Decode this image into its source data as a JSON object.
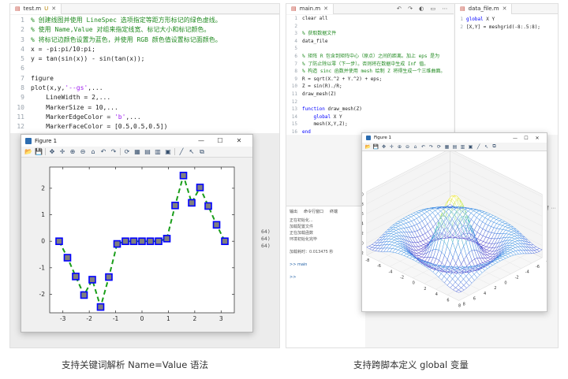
{
  "left_editor": {
    "tab_name": "test.m",
    "tab_marker": "U",
    "lines": [
      {
        "n": "1",
        "tokens": [
          {
            "t": "% 创建线图并使用 LineSpec 选项指定等距方形标记的绿色虚线。",
            "c": "c-cm"
          }
        ]
      },
      {
        "n": "2",
        "tokens": [
          {
            "t": "% 使用 Name,Value 对组来指定线宽、标记大小和标记颜色。",
            "c": "c-cm"
          }
        ]
      },
      {
        "n": "3",
        "tokens": [
          {
            "t": "% 将标记边颜色设置为蓝色，并使用 RGB 颜色值设置标记面颜色。",
            "c": "c-cm"
          }
        ]
      },
      {
        "n": "4",
        "tokens": [
          {
            "t": "x = -pi:pi/10:pi;",
            "c": "c-tx"
          }
        ]
      },
      {
        "n": "5",
        "tokens": [
          {
            "t": "y = tan(sin(x)) - sin(tan(x));",
            "c": "c-tx"
          }
        ]
      },
      {
        "n": "6",
        "tokens": [
          {
            "t": "",
            "c": "c-tx"
          }
        ]
      },
      {
        "n": "7",
        "tokens": [
          {
            "t": "figure",
            "c": "c-tx"
          }
        ]
      },
      {
        "n": "8",
        "tokens": [
          {
            "t": "plot(x,y,",
            "c": "c-tx"
          },
          {
            "t": "'--gs'",
            "c": "c-str"
          },
          {
            "t": ",...",
            "c": "c-tx"
          }
        ]
      },
      {
        "n": "9",
        "tokens": [
          {
            "t": "    LineWidth = 2,...",
            "c": "c-tx"
          }
        ]
      },
      {
        "n": "10",
        "tokens": [
          {
            "t": "    MarkerSize = 10,...",
            "c": "c-tx"
          }
        ]
      },
      {
        "n": "11",
        "tokens": [
          {
            "t": "    MarkerEdgeColor = ",
            "c": "c-tx"
          },
          {
            "t": "'b'",
            "c": "c-str"
          },
          {
            "t": ",...",
            "c": "c-tx"
          }
        ]
      },
      {
        "n": "12",
        "tokens": [
          {
            "t": "    MarkerFaceColor = [0.5,0.5,0.5])",
            "c": "c-tx"
          }
        ]
      }
    ],
    "ghost_text": [
      "64)",
      "64)",
      "64)"
    ]
  },
  "figure1": {
    "title": "Figure 1",
    "controls": [
      "—",
      "☐",
      "✕"
    ],
    "toolbar_icons": [
      "open-icon",
      "save-icon",
      "pan-icon",
      "datatip-icon",
      "zoom-in-icon",
      "zoom-out-icon",
      "home-icon",
      "undo-icon",
      "redo-icon",
      "rotate-icon",
      "grid-icon",
      "legend-icon",
      "colorbar-icon",
      "box-icon",
      "line-icon",
      "pointer-icon",
      "dock-icon"
    ]
  },
  "chart_data": {
    "type": "line",
    "line_style": "--",
    "line_color": "#1a9e1a",
    "marker": "square",
    "marker_face": "#7f7f7f",
    "marker_edge": "#0000ff",
    "x": [
      -3.1416,
      -2.8274,
      -2.5133,
      -2.1991,
      -1.885,
      -1.5708,
      -1.2566,
      -0.9425,
      -0.6283,
      -0.3142,
      0,
      0.3142,
      0.6283,
      0.9425,
      1.2566,
      1.5708,
      1.885,
      2.1991,
      2.5133,
      2.8274,
      3.1416
    ],
    "y": [
      0,
      -0.62,
      -1.33,
      -2.03,
      -1.45,
      -2.48,
      -1.35,
      -0.1,
      0,
      0,
      0,
      0,
      0,
      0.1,
      1.35,
      2.48,
      1.45,
      2.03,
      1.33,
      0.62,
      0
    ],
    "xticks": [
      "-3",
      "-2",
      "-1",
      "0",
      "1",
      "2",
      "3"
    ],
    "xtick_vals": [
      -3,
      -2,
      -1,
      0,
      1,
      2,
      3
    ],
    "yticks": [
      "-2",
      "-1",
      "0",
      "1",
      "2"
    ],
    "ytick_vals": [
      -2,
      -1,
      0,
      1,
      2
    ],
    "xlim": [
      -3.5,
      3.5
    ],
    "ylim": [
      -2.7,
      2.8
    ],
    "grid": false
  },
  "right_editor": {
    "tab_name": "main.m",
    "side_tab_name": "data_file.m",
    "lines": [
      {
        "n": "1",
        "tokens": [
          {
            "t": "clear all",
            "c": "c-tx"
          }
        ]
      },
      {
        "n": "2",
        "tokens": [
          {
            "t": "",
            "c": "c-tx"
          }
        ]
      },
      {
        "n": "3",
        "tokens": [
          {
            "t": "% 获取数据文件",
            "c": "c-cm"
          }
        ]
      },
      {
        "n": "4",
        "tokens": [
          {
            "t": "data_file",
            "c": "c-tx"
          }
        ]
      },
      {
        "n": "5",
        "tokens": [
          {
            "t": "",
            "c": "c-tx"
          }
        ]
      },
      {
        "n": "6",
        "tokens": [
          {
            "t": "% 矩阵 R 包含到矩阵中心（原点）之间的距离。加上 eps 是为",
            "c": "c-cm"
          }
        ]
      },
      {
        "n": "7",
        "tokens": [
          {
            "t": "% 了防止除以零（下一步）。否则将在数据中生成 Inf 值。",
            "c": "c-cm"
          }
        ]
      },
      {
        "n": "8",
        "tokens": [
          {
            "t": "% 构造 sinc 函数并使用 mesh 绘制 Z 将得生成一个三维曲面。",
            "c": "c-cm"
          }
        ]
      },
      {
        "n": "9",
        "tokens": [
          {
            "t": "R = sqrt(X.^2 + Y.^2) + eps;",
            "c": "c-tx"
          }
        ]
      },
      {
        "n": "10",
        "tokens": [
          {
            "t": "Z = sin(R)./R;",
            "c": "c-tx"
          }
        ]
      },
      {
        "n": "11",
        "tokens": [
          {
            "t": "draw_mesh(Z)",
            "c": "c-tx"
          }
        ]
      },
      {
        "n": "12",
        "tokens": [
          {
            "t": "",
            "c": "c-tx"
          }
        ]
      },
      {
        "n": "13",
        "tokens": [
          {
            "t": "function",
            "c": "c-kw"
          },
          {
            "t": " draw_mesh(Z)",
            "c": "c-tx"
          }
        ]
      },
      {
        "n": "14",
        "tokens": [
          {
            "t": "    ",
            "c": "c-tx"
          },
          {
            "t": "global",
            "c": "c-kw"
          },
          {
            "t": " X Y",
            "c": "c-tx"
          }
        ]
      },
      {
        "n": "15",
        "tokens": [
          {
            "t": "    mesh(X,Y,Z);",
            "c": "c-tx"
          }
        ]
      },
      {
        "n": "16",
        "tokens": [
          {
            "t": "end",
            "c": "c-kw"
          }
        ]
      }
    ],
    "side_lines": [
      {
        "n": "1",
        "tokens": [
          {
            "t": "global",
            "c": "c-kw"
          },
          {
            "t": " X Y",
            "c": "c-tx"
          }
        ]
      },
      {
        "n": "2",
        "tokens": [
          {
            "t": "[X,Y] = meshgrid(-8:.5:8);",
            "c": "c-tx"
          }
        ]
      }
    ],
    "console": {
      "tabs": [
        "输出",
        "命令行窗口",
        "终端"
      ],
      "lines": [
        "正在初始化...",
        "加载配置文件",
        "正在加载函数",
        "环境初始化完毕",
        "",
        "加载耗时：0.013475 秒",
        "",
        ">> main",
        "",
        ">> "
      ]
    }
  },
  "figure2": {
    "title": "Figure 1",
    "zticks": [
      "1.0",
      "0.8",
      "0.6",
      "0.4",
      "0.2",
      "0.0",
      "-0.2"
    ],
    "xticks": [
      "-8",
      "-6",
      "-4",
      "-2",
      "0",
      "2",
      "4",
      "6",
      "8"
    ],
    "yticks": [
      "-8",
      "-6",
      "-4",
      "-2",
      "0",
      "2",
      "4",
      "6",
      "8"
    ]
  },
  "captions": {
    "left": "支持关键词解析 Name=Value 语法",
    "right": "支持跨脚本定义 global 变量"
  }
}
